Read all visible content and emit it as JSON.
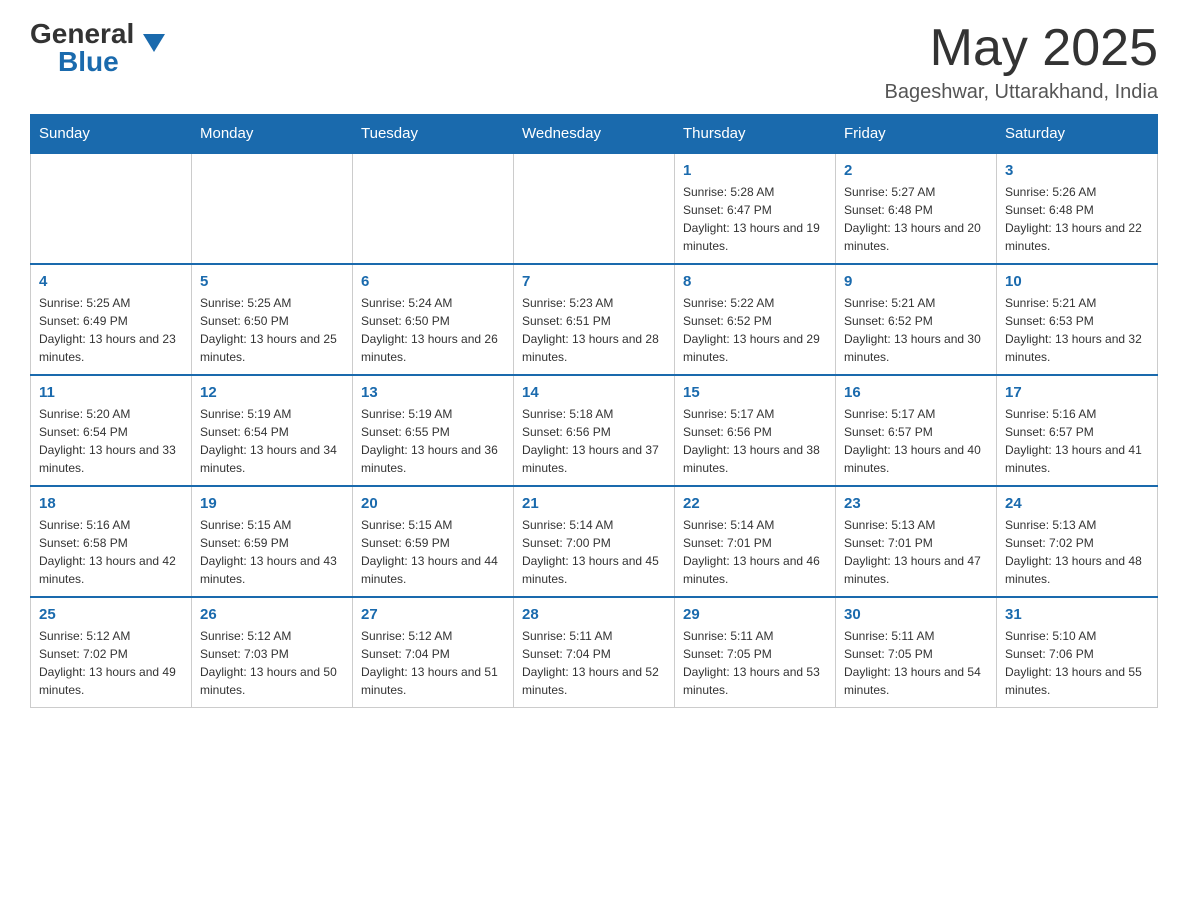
{
  "header": {
    "logo_general": "General",
    "logo_blue": "Blue",
    "month_title": "May 2025",
    "location": "Bageshwar, Uttarakhand, India"
  },
  "days_of_week": [
    "Sunday",
    "Monday",
    "Tuesday",
    "Wednesday",
    "Thursday",
    "Friday",
    "Saturday"
  ],
  "weeks": [
    [
      {
        "day": "",
        "info": ""
      },
      {
        "day": "",
        "info": ""
      },
      {
        "day": "",
        "info": ""
      },
      {
        "day": "",
        "info": ""
      },
      {
        "day": "1",
        "info": "Sunrise: 5:28 AM\nSunset: 6:47 PM\nDaylight: 13 hours and 19 minutes."
      },
      {
        "day": "2",
        "info": "Sunrise: 5:27 AM\nSunset: 6:48 PM\nDaylight: 13 hours and 20 minutes."
      },
      {
        "day": "3",
        "info": "Sunrise: 5:26 AM\nSunset: 6:48 PM\nDaylight: 13 hours and 22 minutes."
      }
    ],
    [
      {
        "day": "4",
        "info": "Sunrise: 5:25 AM\nSunset: 6:49 PM\nDaylight: 13 hours and 23 minutes."
      },
      {
        "day": "5",
        "info": "Sunrise: 5:25 AM\nSunset: 6:50 PM\nDaylight: 13 hours and 25 minutes."
      },
      {
        "day": "6",
        "info": "Sunrise: 5:24 AM\nSunset: 6:50 PM\nDaylight: 13 hours and 26 minutes."
      },
      {
        "day": "7",
        "info": "Sunrise: 5:23 AM\nSunset: 6:51 PM\nDaylight: 13 hours and 28 minutes."
      },
      {
        "day": "8",
        "info": "Sunrise: 5:22 AM\nSunset: 6:52 PM\nDaylight: 13 hours and 29 minutes."
      },
      {
        "day": "9",
        "info": "Sunrise: 5:21 AM\nSunset: 6:52 PM\nDaylight: 13 hours and 30 minutes."
      },
      {
        "day": "10",
        "info": "Sunrise: 5:21 AM\nSunset: 6:53 PM\nDaylight: 13 hours and 32 minutes."
      }
    ],
    [
      {
        "day": "11",
        "info": "Sunrise: 5:20 AM\nSunset: 6:54 PM\nDaylight: 13 hours and 33 minutes."
      },
      {
        "day": "12",
        "info": "Sunrise: 5:19 AM\nSunset: 6:54 PM\nDaylight: 13 hours and 34 minutes."
      },
      {
        "day": "13",
        "info": "Sunrise: 5:19 AM\nSunset: 6:55 PM\nDaylight: 13 hours and 36 minutes."
      },
      {
        "day": "14",
        "info": "Sunrise: 5:18 AM\nSunset: 6:56 PM\nDaylight: 13 hours and 37 minutes."
      },
      {
        "day": "15",
        "info": "Sunrise: 5:17 AM\nSunset: 6:56 PM\nDaylight: 13 hours and 38 minutes."
      },
      {
        "day": "16",
        "info": "Sunrise: 5:17 AM\nSunset: 6:57 PM\nDaylight: 13 hours and 40 minutes."
      },
      {
        "day": "17",
        "info": "Sunrise: 5:16 AM\nSunset: 6:57 PM\nDaylight: 13 hours and 41 minutes."
      }
    ],
    [
      {
        "day": "18",
        "info": "Sunrise: 5:16 AM\nSunset: 6:58 PM\nDaylight: 13 hours and 42 minutes."
      },
      {
        "day": "19",
        "info": "Sunrise: 5:15 AM\nSunset: 6:59 PM\nDaylight: 13 hours and 43 minutes."
      },
      {
        "day": "20",
        "info": "Sunrise: 5:15 AM\nSunset: 6:59 PM\nDaylight: 13 hours and 44 minutes."
      },
      {
        "day": "21",
        "info": "Sunrise: 5:14 AM\nSunset: 7:00 PM\nDaylight: 13 hours and 45 minutes."
      },
      {
        "day": "22",
        "info": "Sunrise: 5:14 AM\nSunset: 7:01 PM\nDaylight: 13 hours and 46 minutes."
      },
      {
        "day": "23",
        "info": "Sunrise: 5:13 AM\nSunset: 7:01 PM\nDaylight: 13 hours and 47 minutes."
      },
      {
        "day": "24",
        "info": "Sunrise: 5:13 AM\nSunset: 7:02 PM\nDaylight: 13 hours and 48 minutes."
      }
    ],
    [
      {
        "day": "25",
        "info": "Sunrise: 5:12 AM\nSunset: 7:02 PM\nDaylight: 13 hours and 49 minutes."
      },
      {
        "day": "26",
        "info": "Sunrise: 5:12 AM\nSunset: 7:03 PM\nDaylight: 13 hours and 50 minutes."
      },
      {
        "day": "27",
        "info": "Sunrise: 5:12 AM\nSunset: 7:04 PM\nDaylight: 13 hours and 51 minutes."
      },
      {
        "day": "28",
        "info": "Sunrise: 5:11 AM\nSunset: 7:04 PM\nDaylight: 13 hours and 52 minutes."
      },
      {
        "day": "29",
        "info": "Sunrise: 5:11 AM\nSunset: 7:05 PM\nDaylight: 13 hours and 53 minutes."
      },
      {
        "day": "30",
        "info": "Sunrise: 5:11 AM\nSunset: 7:05 PM\nDaylight: 13 hours and 54 minutes."
      },
      {
        "day": "31",
        "info": "Sunrise: 5:10 AM\nSunset: 7:06 PM\nDaylight: 13 hours and 55 minutes."
      }
    ]
  ]
}
